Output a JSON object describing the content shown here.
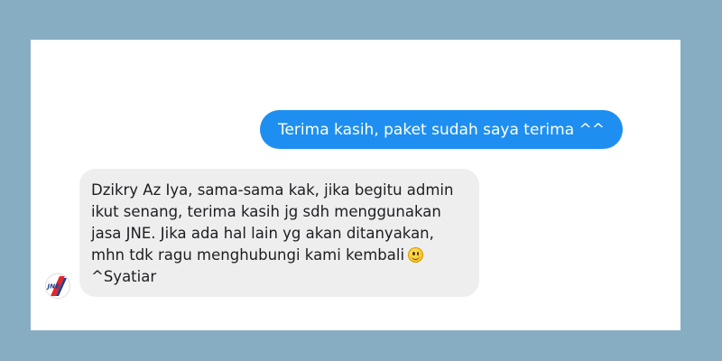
{
  "conversation": {
    "outgoing": {
      "text": "Terima kasih, paket sudah saya terima ^^"
    },
    "incoming": {
      "lines": [
        "Dzikry Az Iya, sama-sama kak, jika begitu admin",
        "ikut senang, terima kasih jg sdh menggunakan",
        "jasa JNE. Jika ada hal lain yg akan ditanyakan,",
        "mhn tdk ragu menghubungi kami kembali",
        "^Syatiar"
      ],
      "emoji": "slightly-smiling-face-emoji",
      "avatar": {
        "icon": "jne-logo-icon",
        "logo_text": "JNE"
      }
    }
  },
  "colors": {
    "page_background": "#87adc3",
    "outgoing_bubble": "#1e8ff0",
    "incoming_bubble": "#eeeeef",
    "logo_red": "#e3262c",
    "logo_blue": "#1d3f8f"
  }
}
